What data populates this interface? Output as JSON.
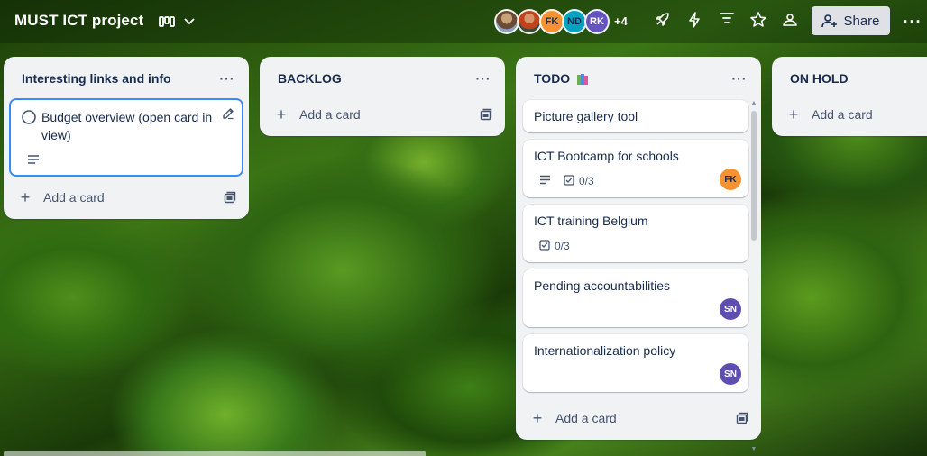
{
  "board": {
    "title": "MUST ICT project"
  },
  "header": {
    "members": [
      {
        "initials": "",
        "color": "#8ba4c0"
      },
      {
        "initials": "",
        "color": "#c0431c"
      },
      {
        "initials": "FK",
        "color": "#f79232"
      },
      {
        "initials": "ND",
        "color": "#00a3bf"
      },
      {
        "initials": "RK",
        "color": "#6554c0"
      }
    ],
    "more_members": "+4",
    "share_label": "Share",
    "icons": [
      "board-views-icon",
      "chevron-down-icon",
      "rocket-icon",
      "lightning-icon",
      "filter-icon",
      "star-icon",
      "workspace-visibility-icon",
      "share-person-icon",
      "more-icon"
    ]
  },
  "lists": [
    {
      "title": "Interesting links and info",
      "add_label": "Add a card",
      "cards": [
        {
          "title": "Budget overview (open card in view)",
          "has_description": true,
          "editing": true
        }
      ]
    },
    {
      "title": "BACKLOG",
      "add_label": "Add a card",
      "cards": []
    },
    {
      "title": "TODO",
      "emoji": "📚",
      "add_label": "Add a card",
      "cards": [
        {
          "title": "Picture gallery tool"
        },
        {
          "title": "ICT Bootcamp for schools",
          "has_description": true,
          "checklist": "0/3",
          "member": "FK",
          "member_color": "#f79232"
        },
        {
          "title": "ICT training Belgium",
          "checklist": "0/3"
        },
        {
          "title": "Pending accountabilities",
          "member": "SN",
          "member_color": "#5e4db2"
        },
        {
          "title": "Internationalization policy",
          "member": "SN",
          "member_color": "#5e4db2"
        }
      ]
    },
    {
      "title": "ON HOLD",
      "add_label": "Add a card",
      "cards": []
    }
  ]
}
